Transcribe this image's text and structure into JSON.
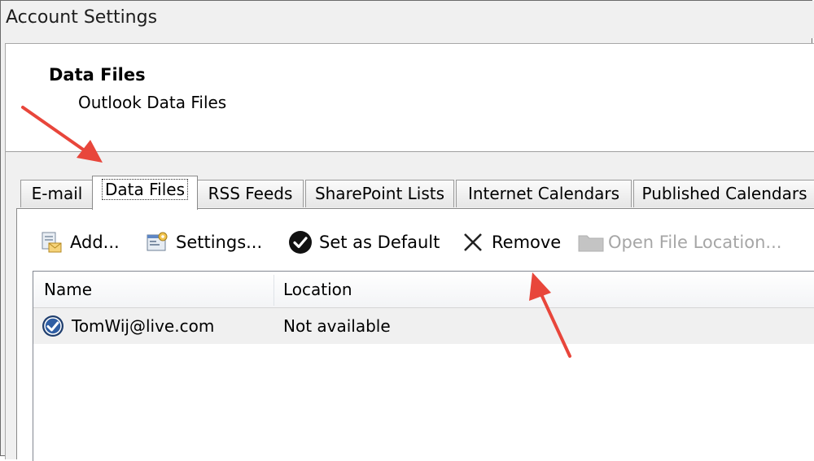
{
  "window": {
    "title": "Account Settings"
  },
  "header": {
    "title": "Data Files",
    "subtitle": "Outlook Data Files"
  },
  "tabs": [
    {
      "label": "E-mail"
    },
    {
      "label": "Data Files"
    },
    {
      "label": "RSS Feeds"
    },
    {
      "label": "SharePoint Lists"
    },
    {
      "label": "Internet Calendars"
    },
    {
      "label": "Published Calendars"
    }
  ],
  "toolbar": {
    "add_label": "Add...",
    "settings_label": "Settings...",
    "default_label": "Set as Default",
    "remove_label": "Remove",
    "open_location_label": "Open File Location..."
  },
  "table": {
    "columns": [
      "Name",
      "Location"
    ],
    "rows": [
      {
        "name": "TomWij@live.com",
        "location": "Not available"
      }
    ]
  },
  "colors": {
    "annotation_arrow": "#e8463b",
    "disabled_text": "#a6a6a6"
  }
}
